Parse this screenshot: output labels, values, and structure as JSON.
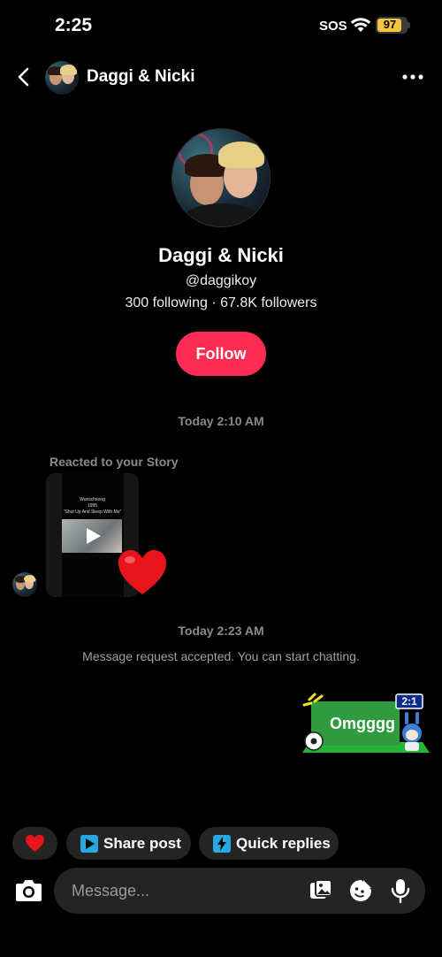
{
  "status_bar": {
    "time": "2:25",
    "carrier": "SOS",
    "battery": "97"
  },
  "header": {
    "title": "Daggi & Nicki"
  },
  "profile": {
    "name": "Daggi & Nicki",
    "handle": "@daggikoy",
    "stats": "300 following · 67.8K followers",
    "follow_label": "Follow"
  },
  "conversation": {
    "timestamp_1": "Today 2:10 AM",
    "reacted_label": "Reacted to your Story",
    "story_caption_1": "Wunschsong",
    "story_caption_2": "1995",
    "story_caption_3": "\"Shut Up And Sleep With Me\"",
    "reaction_emoji": "heart",
    "timestamp_2": "Today 2:23 AM",
    "system_message": "Message request accepted. You can start chatting.",
    "sticker_text": "Omgggg",
    "sticker_score": "2:1"
  },
  "quick_actions": {
    "share_label": "Share post",
    "quick_replies_label": "Quick replies"
  },
  "composer": {
    "placeholder": "Message..."
  },
  "colors": {
    "accent": "#fe2c55",
    "background": "#000000",
    "chip": "#242424",
    "battery": "#f5c542"
  }
}
